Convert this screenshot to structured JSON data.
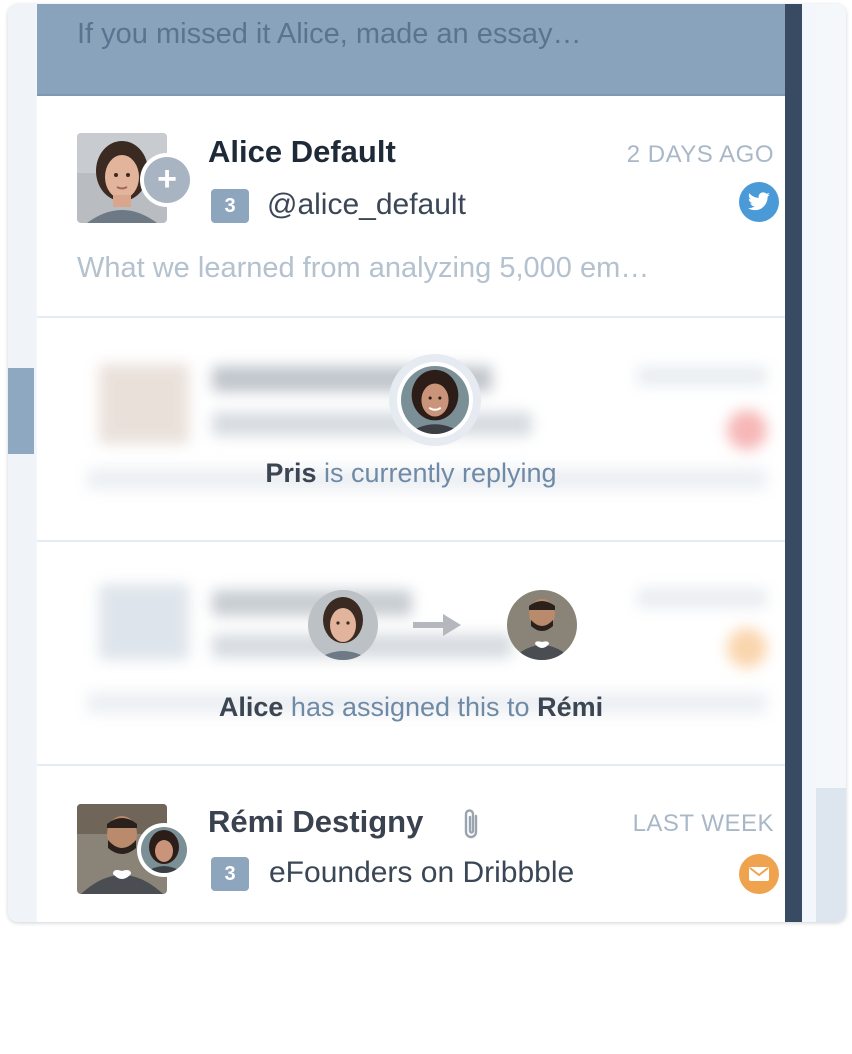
{
  "banner": {
    "text": "If you missed it Alice, made an essay…"
  },
  "conversations": [
    {
      "name": "Alice Default",
      "time": "2 DAYS AGO",
      "count": "3",
      "handle": "@alice_default",
      "preview": "What we learned from analyzing 5,000 em…",
      "service": "twitter-icon",
      "service_color": "#4a9ad8"
    },
    {
      "name": "Rémi Destigny",
      "time": "LAST WEEK",
      "count": "3",
      "subject": "eFounders on Dribbble",
      "service": "email-icon",
      "service_color": "#f0a34f"
    }
  ],
  "replying": {
    "user": "Pris",
    "message": "is currently replying"
  },
  "assignment": {
    "from": "Alice",
    "message": "has assigned this to",
    "to": "Rémi"
  },
  "colors": {
    "banner": "#8aa3bc",
    "scrollbar": "#394b63",
    "badge": "#8ea5be",
    "accent_text": "#6f8aa6"
  }
}
